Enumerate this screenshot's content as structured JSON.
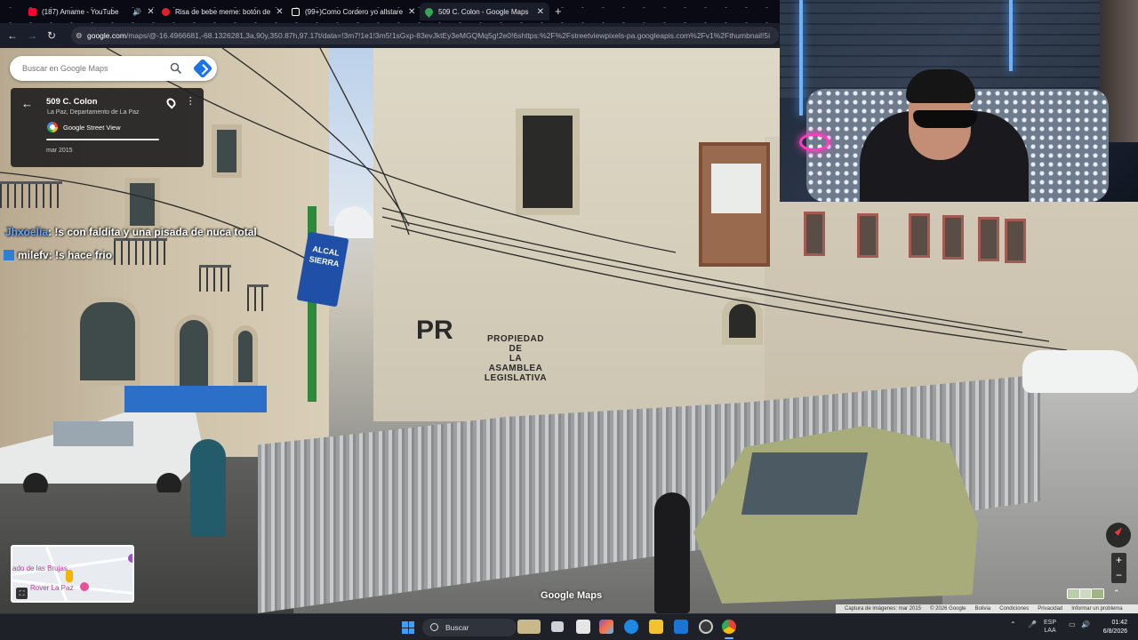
{
  "browser": {
    "tabs": [
      {
        "title": "(187) Amame - YouTube",
        "favicon_color": "#ff0033"
      },
      {
        "title": "Risa de bebe meme: botón de",
        "favicon_color": "#e0202a"
      },
      {
        "title": "(99+)Como Cordero yo allstare",
        "favicon_color": "#ffffff"
      },
      {
        "title": "509 C. Colon - Google Maps",
        "favicon_color": "#34a853"
      }
    ],
    "new_tab_label": "+",
    "url_host": "google.com",
    "url_path": "/maps/@-16.4966681,-68.1326281,3a,90y,350.87h,97.17t/data=!3m7!1e1!3m5!1sGxp-83evJktEy3eMGQMq5g!2e0!6shttps:%2F%2Fstreetviewpixels-pa.googleapis.com%2Fv1%2Fthumbnail!5i"
  },
  "maps": {
    "search_placeholder": "Buscar en Google Maps",
    "place_title": "509 C. Colon",
    "place_subtitle": "La Paz, Departamento de La Paz",
    "streetview_label": "Google Street View",
    "capture_date": "mar 2015",
    "watermark": "Google Maps",
    "attribution": [
      "Captura de imágenes: mar 2015",
      "© 2026 Google",
      "Bolivia",
      "Condiciones",
      "Privacidad",
      "Informar un problema"
    ],
    "minimap": {
      "label_1": "ado de las Brujas",
      "label_2": "Rover La Paz"
    },
    "zoom_in": "+",
    "zoom_out": "−",
    "accent_color": "#1a73e8"
  },
  "scene": {
    "wall_text": "PROPIEDAD\nDE\nLA\nASAMBLEA LEGISLATIVA",
    "graffiti": "PR",
    "street_sign": "ALCAL\nSIERRA"
  },
  "chat": [
    {
      "user": "Jhxoelia",
      "message": ": !s con faldita y una pisada de nuca total"
    },
    {
      "user": "milefv",
      "message": ": !s hace frio"
    }
  ],
  "taskbar": {
    "search_label": "Buscar",
    "language_1": "ESP",
    "language_2": "LAA",
    "time": "01:42",
    "date": "6/8/2026"
  }
}
